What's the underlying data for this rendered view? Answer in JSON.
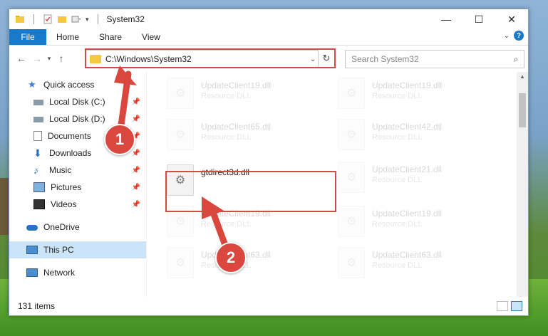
{
  "window": {
    "title": "System32",
    "controls": {
      "minimize": "—",
      "maximize": "☐",
      "close": "✕"
    }
  },
  "ribbon": {
    "tabs": [
      "File",
      "Home",
      "Share",
      "View"
    ],
    "help": "?"
  },
  "nav": {
    "address": "C:\\Windows\\System32",
    "search_placeholder": "Search System32"
  },
  "sidebar": {
    "items": [
      {
        "label": "Quick access",
        "icon": "star-icon"
      },
      {
        "label": "Local Disk (C:)",
        "icon": "drive-icon",
        "pinned": true
      },
      {
        "label": "Local Disk (D:)",
        "icon": "drive-icon",
        "pinned": true
      },
      {
        "label": "Documents",
        "icon": "documents-icon",
        "pinned": true
      },
      {
        "label": "Downloads",
        "icon": "download-icon",
        "pinned": true
      },
      {
        "label": "Music",
        "icon": "music-icon",
        "pinned": true
      },
      {
        "label": "Pictures",
        "icon": "pictures-icon",
        "pinned": true
      },
      {
        "label": "Videos",
        "icon": "videos-icon",
        "pinned": true
      },
      {
        "label": "OneDrive",
        "icon": "cloud-icon"
      },
      {
        "label": "This PC",
        "icon": "computer-icon",
        "selected": true
      },
      {
        "label": "Network",
        "icon": "network-icon"
      }
    ]
  },
  "files": {
    "left": [
      {
        "name": "UpdateClient19.dll",
        "type": "Resource DLL"
      },
      {
        "name": "UpdateClient65.dll",
        "type": "Resource DLL"
      },
      {
        "name": "gtdirect3d.dll",
        "type": ""
      },
      {
        "name": "UpdateClient19.dll",
        "type": "Resource DLL"
      },
      {
        "name": "UpdateClient63.dll",
        "type": "Resource DLL"
      }
    ],
    "right": [
      {
        "name": "UpdateClient19.dll",
        "type": "Resource DLL"
      },
      {
        "name": "UpdateClient42.dll",
        "type": "Resource DLL"
      },
      {
        "name": "UpdateClient21.dll",
        "type": "Resource DLL"
      },
      {
        "name": "UpdateClient19.dll",
        "type": "Resource DLL"
      },
      {
        "name": "UpdateClient63.dll",
        "type": "Resource DLL"
      }
    ]
  },
  "status": {
    "item_count": "131 items"
  },
  "annotations": {
    "step1": "1",
    "step2": "2",
    "color": "#d9473f"
  }
}
